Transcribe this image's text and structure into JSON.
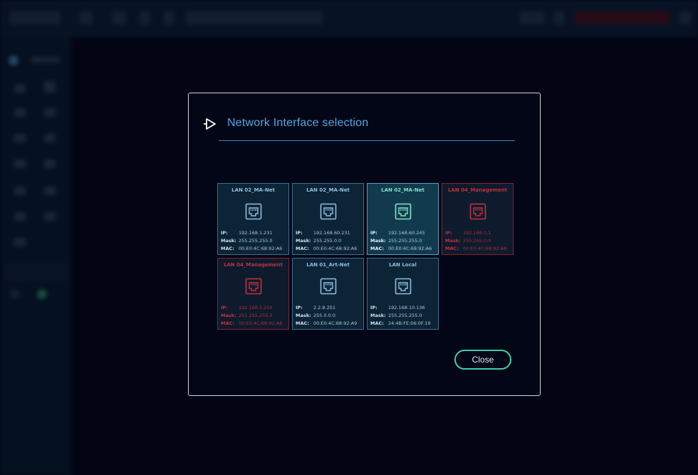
{
  "colors": {
    "accent": "#52a8e6",
    "selected": "#7fe4c4",
    "management": "#c63040",
    "close_border": "#3fd0a8"
  },
  "dialog": {
    "title": "Network Interface selection",
    "title_icon": "play-branch-icon",
    "close_label": "Close"
  },
  "labels": {
    "ip": "IP:",
    "mask": "Mask:",
    "mac": "MAC:"
  },
  "interfaces": [
    {
      "name": "LAN 02_MA-Net",
      "ip": "192.168.1.231",
      "mask": "255.255.255.0",
      "mac": "00:E0:4C:68:92:A6",
      "state": "normal"
    },
    {
      "name": "LAN 02_MA-Net",
      "ip": "192.168.60.231",
      "mask": "255.255.0.0",
      "mac": "00:E0:4C:68:92:A6",
      "state": "normal"
    },
    {
      "name": "LAN 02_MA-Net",
      "ip": "192.168.60.245",
      "mask": "255.255.255.0",
      "mac": "00:E0:4C:68:92:A6",
      "state": "selected"
    },
    {
      "name": "LAN 04_Management",
      "ip": "192.168.0.1",
      "mask": "255.255.0.0",
      "mac": "00:E0:4C:68:92:A8",
      "state": "management"
    },
    {
      "name": "LAN 04_Management",
      "ip": "192.168.1.250",
      "mask": "255.255.255.0",
      "mac": "00:E0:4C:68:92:A8",
      "state": "management"
    },
    {
      "name": "LAN 01_Art-Net",
      "ip": "2.2.8.251",
      "mask": "255.0.0.0",
      "mac": "00:E0:4C:68:92:A9",
      "state": "normal"
    },
    {
      "name": "LAN Local",
      "ip": "192.168.10.136",
      "mask": "255.255.255.0",
      "mac": "24:4B:FE:06:0F:19",
      "state": "normal"
    }
  ]
}
